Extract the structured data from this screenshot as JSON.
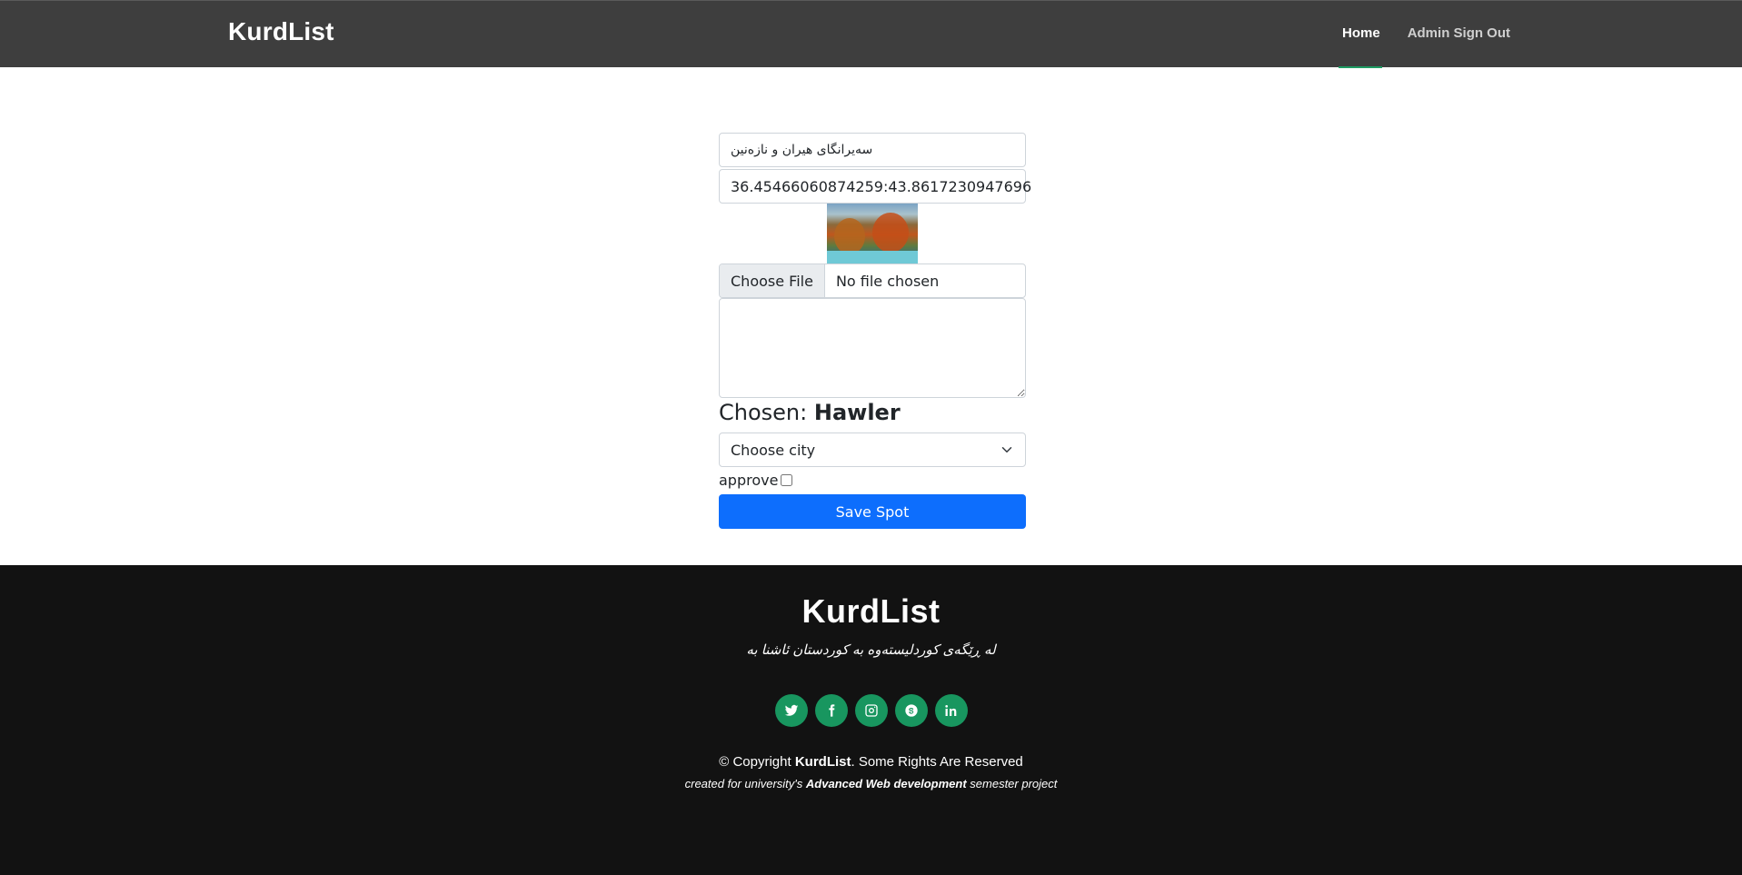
{
  "header": {
    "brand": "KurdList",
    "nav": {
      "home": "Home",
      "signout": "Admin Sign Out"
    }
  },
  "form": {
    "name_value": "سەیرانگای هیران و نازەنین",
    "coords_value": "36.45466060874259:43.8617230947696",
    "file_button": "Choose File",
    "file_status": "No file chosen",
    "chosen_prefix": "Chosen:",
    "chosen_city": "Hawler",
    "city_select": "Choose city",
    "approve_label": "approve",
    "save_button": "Save Spot"
  },
  "footer": {
    "brand": "KurdList",
    "tagline": "لە ڕێگەی کوردلیستەوە بە کوردستان ئاشنا بە",
    "socials": [
      "twitter-icon",
      "facebook-icon",
      "instagram-icon",
      "skype-icon",
      "linkedin-icon"
    ],
    "copyright_prefix": "© Copyright",
    "copyright_brand": "KurdList",
    "copyright_suffix": ". Some Rights Are Reserved",
    "credit_prefix": "created for university's",
    "credit_bold": "Advanced Web development",
    "credit_suffix": "semester project"
  },
  "colors": {
    "header_bg": "#3e3e3e",
    "accent_green": "#18965f",
    "primary_blue": "#0d6efd",
    "footer_bg": "#121212"
  }
}
